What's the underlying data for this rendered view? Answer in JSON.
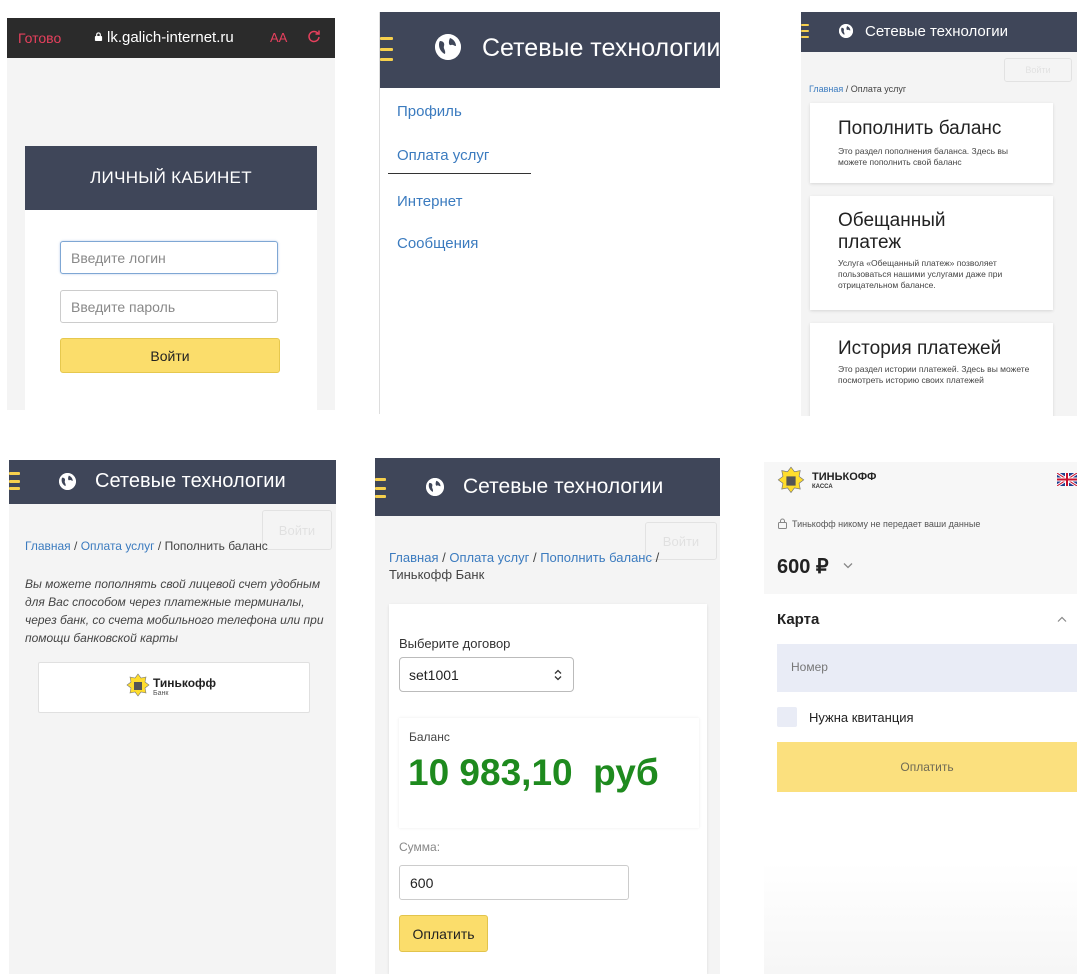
{
  "colors": {
    "navbar": "#3f4659",
    "accent_yellow": "#fbdd6b",
    "link": "#3b7bbf",
    "balance_green": "#1e8a1e",
    "ios_red": "#e6405d"
  },
  "site": {
    "brand": "Сетевые технологии",
    "login_button_ghost": "Войти",
    "menu_icon": "hamburger-icon",
    "logo_icon": "globe-icon"
  },
  "login_screen": {
    "browser": {
      "done": "Готово",
      "url": "lk.galich-internet.ru",
      "text_size": "AA"
    },
    "header": "ЛИЧНЫЙ КАБИНЕТ",
    "login_placeholder": "Введите логин",
    "password_placeholder": "Введите пароль",
    "submit": "Войти"
  },
  "menu_screen": {
    "items": [
      {
        "label": "Профиль"
      },
      {
        "label": "Оплата услуг"
      },
      {
        "label": "Интернет"
      },
      {
        "label": "Сообщения"
      }
    ]
  },
  "services_screen": {
    "breadcrumb": {
      "home": "Главная",
      "sep": " / ",
      "current": "Оплата услуг"
    },
    "cards": [
      {
        "title": "Пополнить баланс",
        "desc": "Это раздел пополнения баланса. Здесь вы можете пополнить свой баланс"
      },
      {
        "title": "Обещанный платеж",
        "desc": "Услуга «Обещанный платеж» позволяет пользоваться нашими услугами даже при отрицательном балансе."
      },
      {
        "title": "История платежей",
        "desc": "Это раздел истории платежей. Здесь вы можете посмотреть историю своих платежей"
      }
    ]
  },
  "topup_screen": {
    "breadcrumb": {
      "home": "Главная",
      "sep": " / ",
      "section": "Оплата услуг",
      "current": "Пополнить баланс"
    },
    "intro": "Вы можете пополнять свой лицевой счет удобным для Вас способом через платежные терминалы, через банк, со счета мобильного телефона или при помощи банковской карты",
    "bank": {
      "name": "Тинькофф",
      "sub": "Банк"
    }
  },
  "tinkoff_screen": {
    "breadcrumb": {
      "home": "Главная",
      "sep": " / ",
      "section": "Оплата услуг",
      "subsection": "Пополнить баланс",
      "current": "Тинькофф Банк"
    },
    "contract_label": "Выберите договор",
    "contract_value": "set1001",
    "balance_label": "Баланс",
    "balance_value": "10 983,10  руб",
    "amount_label": "Сумма:",
    "amount_value": "600",
    "submit": "Оплатить"
  },
  "kassa_screen": {
    "brand": "ТИНЬКОФФ",
    "brand_sub": "КАССА",
    "privacy": "Тинькофф никому не передает ваши данные",
    "amount": "600 ₽",
    "section": "Карта",
    "card_placeholder": "Номер",
    "receipt": "Нужна квитанция",
    "submit": "Оплатить",
    "language_icon": "uk-flag-icon"
  }
}
